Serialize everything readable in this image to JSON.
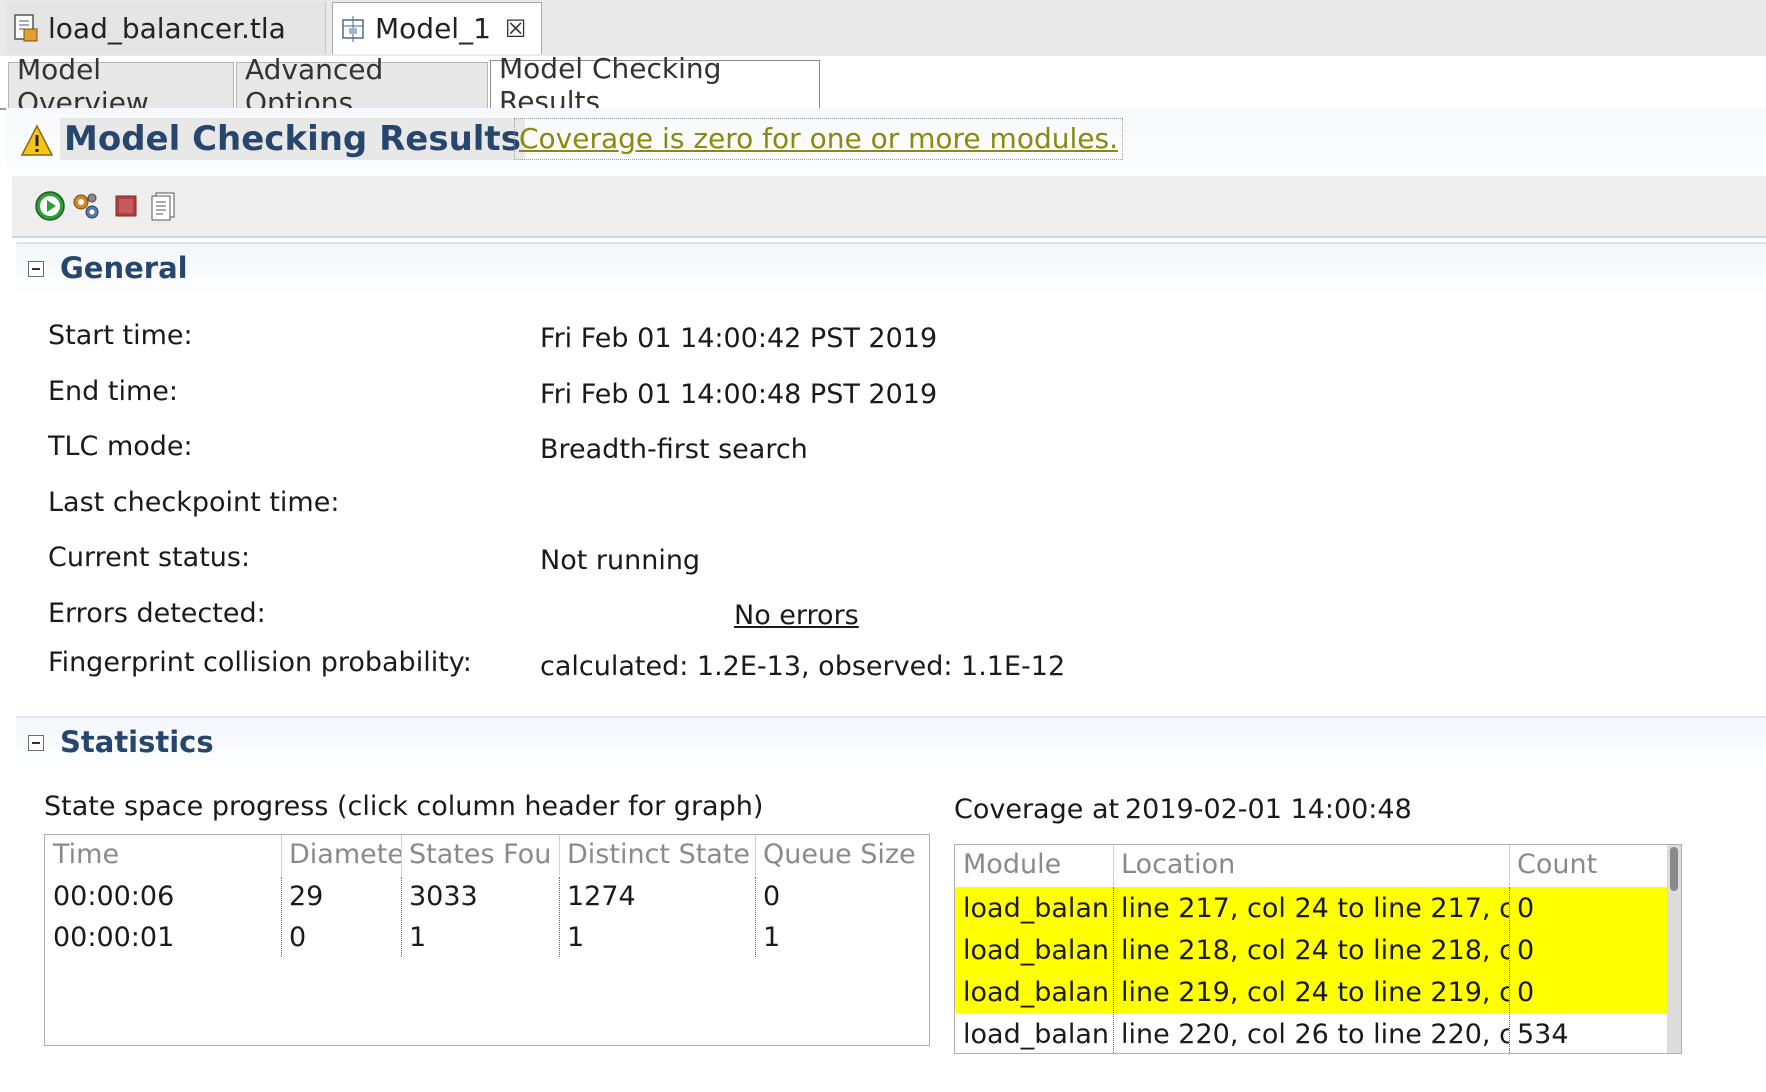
{
  "editor_tabs": [
    {
      "label": "load_balancer.tla",
      "icon": "tla-file-icon"
    },
    {
      "label": "Model_1",
      "icon": "model-icon",
      "close": "☒"
    }
  ],
  "page_tabs": [
    "Model Overview",
    "Advanced Options",
    "Model Checking Results"
  ],
  "header": {
    "title": "Model Checking Results",
    "warning_link": "Coverage is zero for one or more modules."
  },
  "toolbar_icons": [
    "run-icon",
    "configure-icon",
    "stop-icon",
    "report-icon"
  ],
  "general": {
    "title": "General",
    "rows": [
      {
        "label": "Start time:",
        "value": "Fri Feb 01 14:00:42 PST 2019"
      },
      {
        "label": "End time:",
        "value": "Fri Feb 01 14:00:48 PST 2019"
      },
      {
        "label": "TLC mode:",
        "value": "Breadth-first search"
      },
      {
        "label": "Last checkpoint time:",
        "value": ""
      },
      {
        "label": "Current status:",
        "value": "Not running"
      },
      {
        "label": "Errors detected:",
        "value": "No errors"
      },
      {
        "label": "Fingerprint collision probability:",
        "value": "calculated: 1.2E-13,  observed: 1.1E-12"
      }
    ]
  },
  "statistics": {
    "title": "Statistics",
    "progress_caption": "State space progress (click column header for graph)",
    "progress_headers": [
      "Time",
      "Diamete",
      "States Fou",
      "Distinct State",
      "Queue Size"
    ],
    "progress_rows": [
      [
        "00:00:06",
        "29",
        "3033",
        "1274",
        "0"
      ],
      [
        "00:00:01",
        "0",
        "1",
        "1",
        "1"
      ]
    ],
    "coverage_label": "Coverage at",
    "coverage_time": "2019-02-01 14:00:48",
    "coverage_headers": [
      "Module",
      "Location",
      "Count"
    ],
    "coverage_rows": [
      {
        "module": "load_balan",
        "location": "line 217, col 24 to line 217, col",
        "count": "0",
        "zero": true
      },
      {
        "module": "load_balan",
        "location": "line 218, col 24 to line 218, col",
        "count": "0",
        "zero": true
      },
      {
        "module": "load_balan",
        "location": "line 219, col 24 to line 219, col",
        "count": "0",
        "zero": true
      },
      {
        "module": "load_balan",
        "location": "line 220, col 26 to line 220, col",
        "count": "534",
        "zero": false
      }
    ],
    "highlight_color": "#ffff00"
  }
}
